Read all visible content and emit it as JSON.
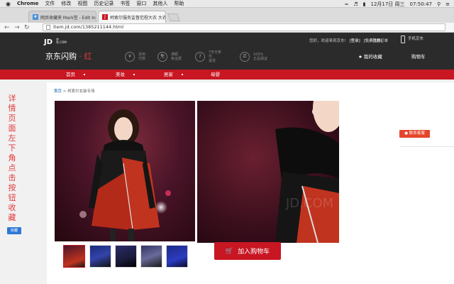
{
  "menubar": {
    "apple": "",
    "app": "Chrome",
    "items": [
      "文件",
      "修改",
      "视图",
      "历史记录",
      "书签",
      "窗口",
      "其他人",
      "帮助"
    ],
    "status": {
      "date": "12月17日 周三",
      "time": "07:50:47"
    }
  },
  "tabs": [
    {
      "title": "网页收藏夹 Mark签 - Edit In...",
      "favicon": "bookmark-icon",
      "active": false
    },
    {
      "title": "柯索尔服务监督范程大衣 大衣",
      "favicon": "jd-icon",
      "active": true
    }
  ],
  "toolbar": {
    "url": "item.jd.com/1385211144.html"
  },
  "jd": {
    "logo": "JD",
    "logo_sub": "京东.COM",
    "flash": "京东闪购",
    "flash_suffix": "· 红",
    "features": [
      {
        "icon": "¥",
        "line1": "货到",
        "line2": "付款"
      },
      {
        "icon": "免",
        "line1": "满额",
        "line2": "免运费"
      },
      {
        "icon": "7",
        "line1": "7天无条件",
        "line2": "退货"
      },
      {
        "icon": "正",
        "line1": "100%",
        "line2": "正品保证"
      }
    ],
    "greeting": "您好，欢迎来到京东!",
    "login": "[登录]",
    "register": "[免费注册]",
    "orders": "我的订单",
    "mobile": "手机京东",
    "my_fav": "我的收藏",
    "cart": "购物车",
    "nav": [
      "首页",
      "美妆",
      "居家",
      "母婴"
    ]
  },
  "breadcrumb": {
    "home": "首页",
    "rest": " > 柯索尔女装专场"
  },
  "thumbnails": 5,
  "add_to_cart": "加入购物车",
  "contact": "联系客服",
  "sidebar_note": "详情页面左下角点击按钮收藏",
  "fav_button": "收藏",
  "colors": {
    "jd_red": "#c81623",
    "header_dark": "#2b2b2b",
    "coat_red": "#c0331f"
  }
}
